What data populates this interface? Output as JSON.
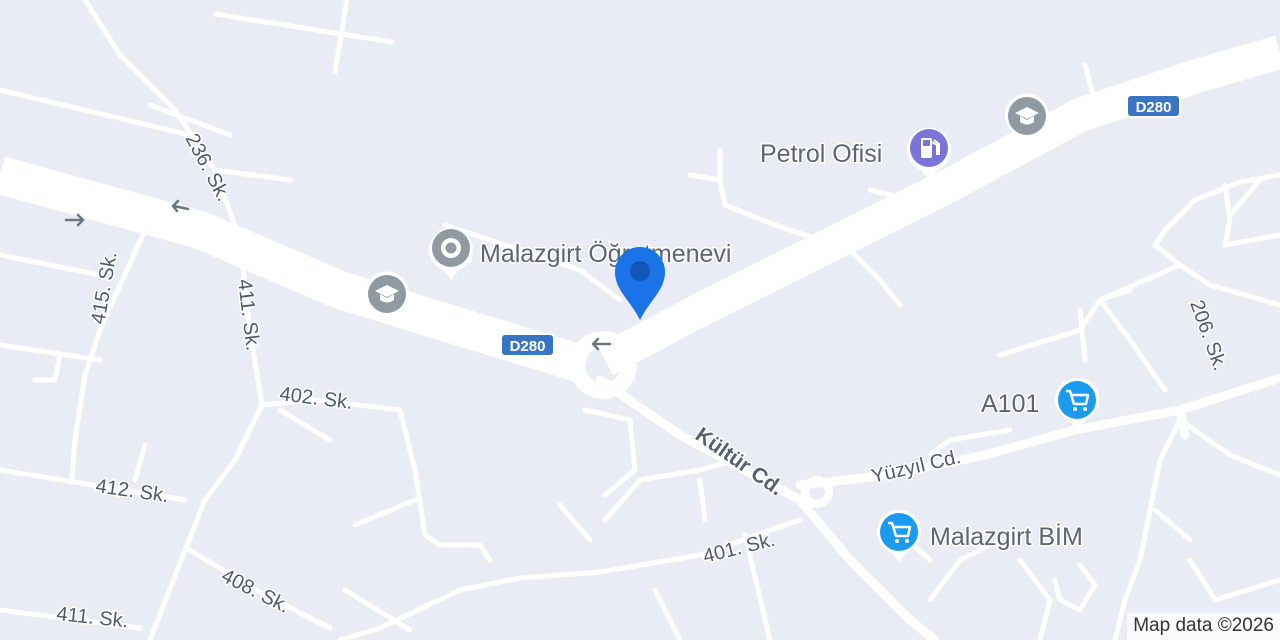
{
  "map": {
    "attribution": "Map data ©2026",
    "colors": {
      "land": "#e9ebf5",
      "road": "#ffffff",
      "highway_shield": "#3a75c4",
      "poi_generic": "#8f9aa3",
      "poi_fuel": "#7a73d9",
      "poi_shopping": "#1a9bf0",
      "marker": "#1b73e8"
    },
    "highway_shields": [
      {
        "id": "shield-1",
        "text": "D280"
      },
      {
        "id": "shield-2",
        "text": "D280"
      }
    ],
    "street_labels": {
      "s236": "236. Sk.",
      "s415": "415. Sk.",
      "s411a": "411. Sk.",
      "s402": "402. Sk.",
      "s412": "412. Sk.",
      "s408": "408. Sk.",
      "s411b": "411. Sk.",
      "kultur": "Kültür Cd.",
      "yuzyil": "Yüzyıl Cd.",
      "s401": "401. Sk.",
      "s206": "206. Sk."
    },
    "pois": {
      "petrol": {
        "label": "Petrol Ofisi",
        "icon": "fuel-icon"
      },
      "ogretmenevi": {
        "label": "Malazgirt Öğretmenevi",
        "icon": "place-icon"
      },
      "a101": {
        "label": "A101",
        "icon": "shopping-cart-icon"
      },
      "bim": {
        "label": "Malazgirt BİM",
        "icon": "shopping-cart-icon"
      },
      "school1": {
        "icon": "school-icon"
      },
      "school2": {
        "icon": "school-icon"
      }
    },
    "marker": {
      "icon": "location-pin-icon"
    },
    "turn_arrows": {
      "icon": "turn-arrow-icon"
    }
  }
}
